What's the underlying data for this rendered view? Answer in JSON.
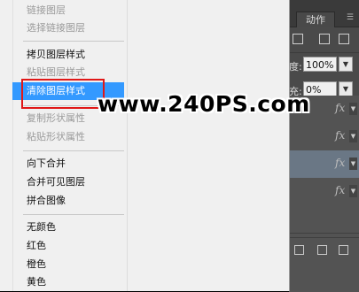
{
  "menu": {
    "items": [
      {
        "label": "链接图层",
        "enabled": false
      },
      {
        "label": "选择链接图层",
        "enabled": false
      },
      {
        "label": "拷贝图层样式",
        "enabled": true
      },
      {
        "label": "粘贴图层样式",
        "enabled": false
      },
      {
        "label": "清除图层样式",
        "enabled": true,
        "highlighted": true
      },
      {
        "label": "复制形状属性",
        "enabled": false
      },
      {
        "label": "粘贴形状属性",
        "enabled": false
      },
      {
        "label": "向下合并",
        "enabled": true
      },
      {
        "label": "合并可见图层",
        "enabled": true
      },
      {
        "label": "拼合图像",
        "enabled": true
      },
      {
        "label": "无颜色",
        "enabled": true
      },
      {
        "label": "红色",
        "enabled": true
      },
      {
        "label": "橙色",
        "enabled": true
      },
      {
        "label": "黄色",
        "enabled": true
      }
    ],
    "highlight_color": "#3399ff"
  },
  "panel": {
    "tab_label": "动作",
    "opacity_value": "100%",
    "fill_value": "0%",
    "fx_label": "fx"
  },
  "watermark": "www.240PS.com"
}
